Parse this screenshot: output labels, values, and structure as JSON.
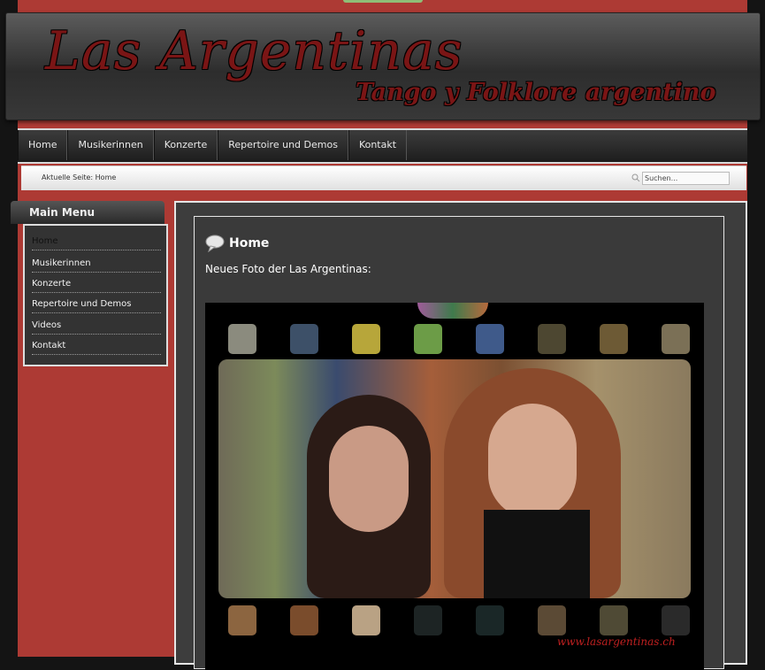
{
  "header": {
    "title": "Las Argentinas",
    "subtitle": "Tango y Folklore argentino"
  },
  "nav": {
    "items": [
      "Home",
      "Musikerinnen",
      "Konzerte",
      "Repertoire und Demos",
      "Kontakt"
    ]
  },
  "breadcrumb": {
    "text": "Aktuelle Seite: Home",
    "search_placeholder": "Suchen..."
  },
  "sidebar": {
    "title": "Main Menu",
    "items": [
      "Home",
      "Musikerinnen",
      "Konzerte",
      "Repertoire und Demos",
      "Videos",
      "Kontakt"
    ]
  },
  "content": {
    "title": "Home",
    "text": "Neues Foto der Las Argentinas:",
    "watermark": "www.lasargentinas.ch"
  },
  "colors": {
    "accent": "#ad3a34",
    "dark": "#3d3d3d",
    "logo": "#7a1515"
  }
}
